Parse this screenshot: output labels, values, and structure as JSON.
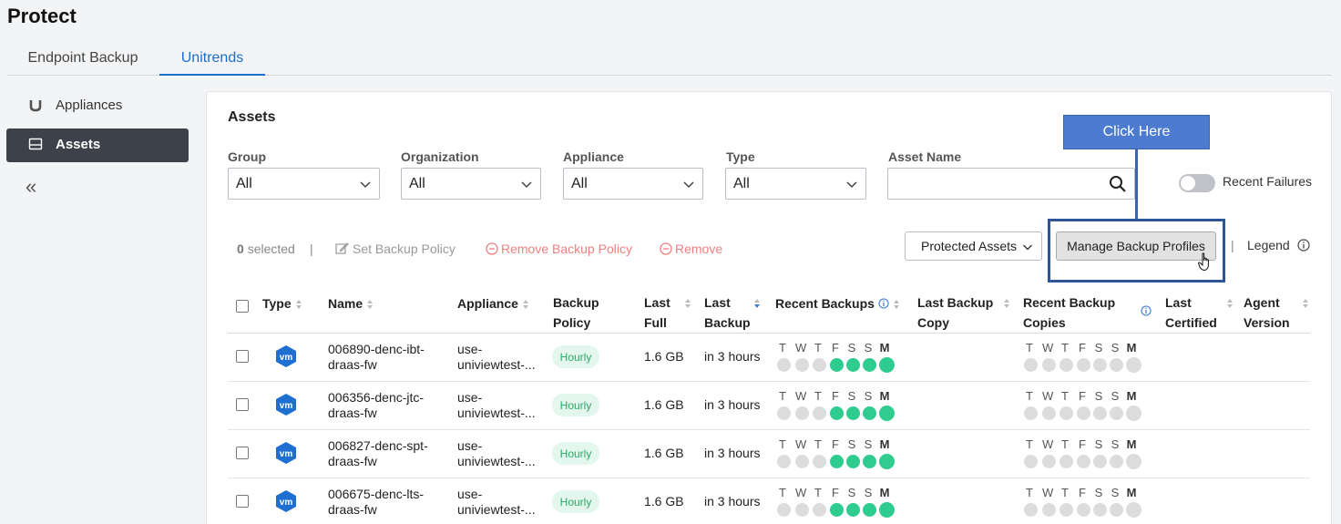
{
  "page": {
    "title": "Protect"
  },
  "tabs": [
    {
      "label": "Endpoint Backup",
      "active": false
    },
    {
      "label": "Unitrends",
      "active": true
    }
  ],
  "sidebar": {
    "items": [
      {
        "label": "Appliances",
        "icon": "unitrends-u-icon",
        "active": false
      },
      {
        "label": "Assets",
        "icon": "drive-icon",
        "active": true
      }
    ],
    "collapse_label": "«"
  },
  "assets": {
    "title": "Assets",
    "filters": [
      {
        "label": "Group",
        "value": "All"
      },
      {
        "label": "Organization",
        "value": "All"
      },
      {
        "label": "Appliance",
        "value": "All"
      },
      {
        "label": "Type",
        "value": "All"
      }
    ],
    "asset_name": {
      "label": "Asset Name",
      "value": "",
      "placeholder": ""
    },
    "recent_failures": {
      "label": "Recent Failures",
      "on": false
    },
    "callout": "Click Here",
    "actions": {
      "selected_count": "0",
      "selected_label": "selected",
      "separator": "|",
      "set_backup_policy": "Set Backup Policy",
      "remove_backup_policy": "Remove Backup Policy",
      "remove": "Remove",
      "protected_assets": "Protected Assets",
      "manage_backup_profiles": "Manage Backup Profiles",
      "legend": "Legend"
    },
    "columns": {
      "type": "Type",
      "name": "Name",
      "appliance": "Appliance",
      "backup_policy_1": "Backup",
      "backup_policy_2": "Policy",
      "last_full_1": "Last",
      "last_full_2": "Full",
      "last_backup_1": "Last",
      "last_backup_2": "Backup",
      "recent_backups": "Recent Backups",
      "last_backup_copy_1": "Last Backup",
      "last_backup_copy_2": "Copy",
      "recent_backup_copies_1": "Recent Backup",
      "recent_backup_copies_2": "Copies",
      "last_certified_1": "Last",
      "last_certified_2": "Certified",
      "agent_version_1": "Agent",
      "agent_version_2": "Version"
    },
    "day_labels": [
      "T",
      "W",
      "T",
      "F",
      "S",
      "S",
      "M"
    ],
    "rows": [
      {
        "type": "vm",
        "name_1": "006890-denc-ibt-",
        "name_2": "draas-fw",
        "appliance_1": "use-",
        "appliance_2": "univiewtest-...",
        "policy": "Hourly",
        "last_full": "1.6 GB",
        "last_backup": "in 3 hours",
        "recent_backups": [
          0,
          0,
          0,
          1,
          1,
          1,
          1
        ],
        "recent_copies": [
          0,
          0,
          0,
          0,
          0,
          0,
          0
        ]
      },
      {
        "type": "vm",
        "name_1": "006356-denc-jtc-",
        "name_2": "draas-fw",
        "appliance_1": "use-",
        "appliance_2": "univiewtest-...",
        "policy": "Hourly",
        "last_full": "1.6 GB",
        "last_backup": "in 3 hours",
        "recent_backups": [
          0,
          0,
          0,
          1,
          1,
          1,
          1
        ],
        "recent_copies": [
          0,
          0,
          0,
          0,
          0,
          0,
          0
        ]
      },
      {
        "type": "vm",
        "name_1": "006827-denc-spt-",
        "name_2": "draas-fw",
        "appliance_1": "use-",
        "appliance_2": "univiewtest-...",
        "policy": "Hourly",
        "last_full": "1.6 GB",
        "last_backup": "in 3 hours",
        "recent_backups": [
          0,
          0,
          0,
          1,
          1,
          1,
          1
        ],
        "recent_copies": [
          0,
          0,
          0,
          0,
          0,
          0,
          0
        ]
      },
      {
        "type": "vm",
        "name_1": "006675-denc-lts-",
        "name_2": "draas-fw",
        "appliance_1": "use-",
        "appliance_2": "univiewtest-...",
        "policy": "Hourly",
        "last_full": "1.6 GB",
        "last_backup": "in 3 hours",
        "recent_backups": [
          0,
          0,
          0,
          1,
          1,
          1,
          1
        ],
        "recent_copies": [
          0,
          0,
          0,
          0,
          0,
          0,
          0
        ]
      }
    ]
  }
}
